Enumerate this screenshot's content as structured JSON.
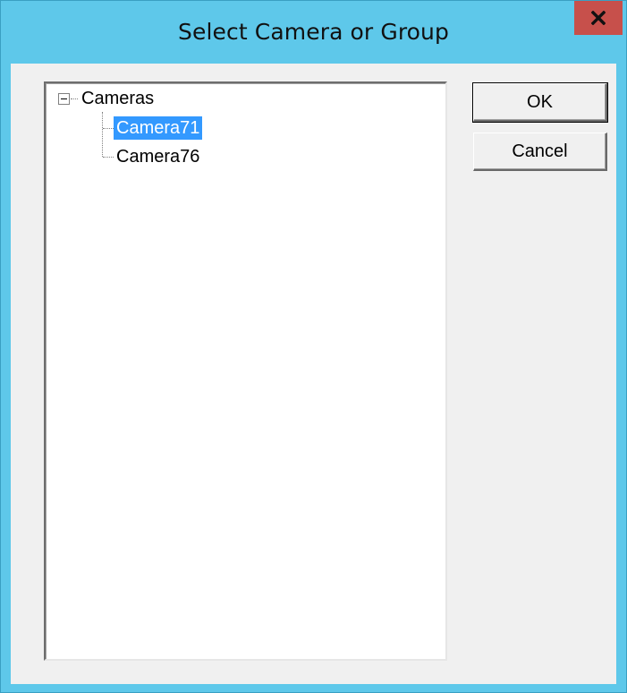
{
  "window": {
    "title": "Select Camera or Group",
    "close_glyph": "x"
  },
  "tree": {
    "root": {
      "label": "Cameras",
      "expander_glyph": "minus",
      "expanded": true
    },
    "children": [
      {
        "label": "Camera71",
        "selected": true
      },
      {
        "label": "Camera76",
        "selected": false
      }
    ]
  },
  "buttons": {
    "ok_label": "OK",
    "cancel_label": "Cancel"
  },
  "colors": {
    "titlebar": "#5ec8ea",
    "close_button": "#c7504b",
    "selection": "#3399ff",
    "dialog_background": "#f0f0f0"
  }
}
